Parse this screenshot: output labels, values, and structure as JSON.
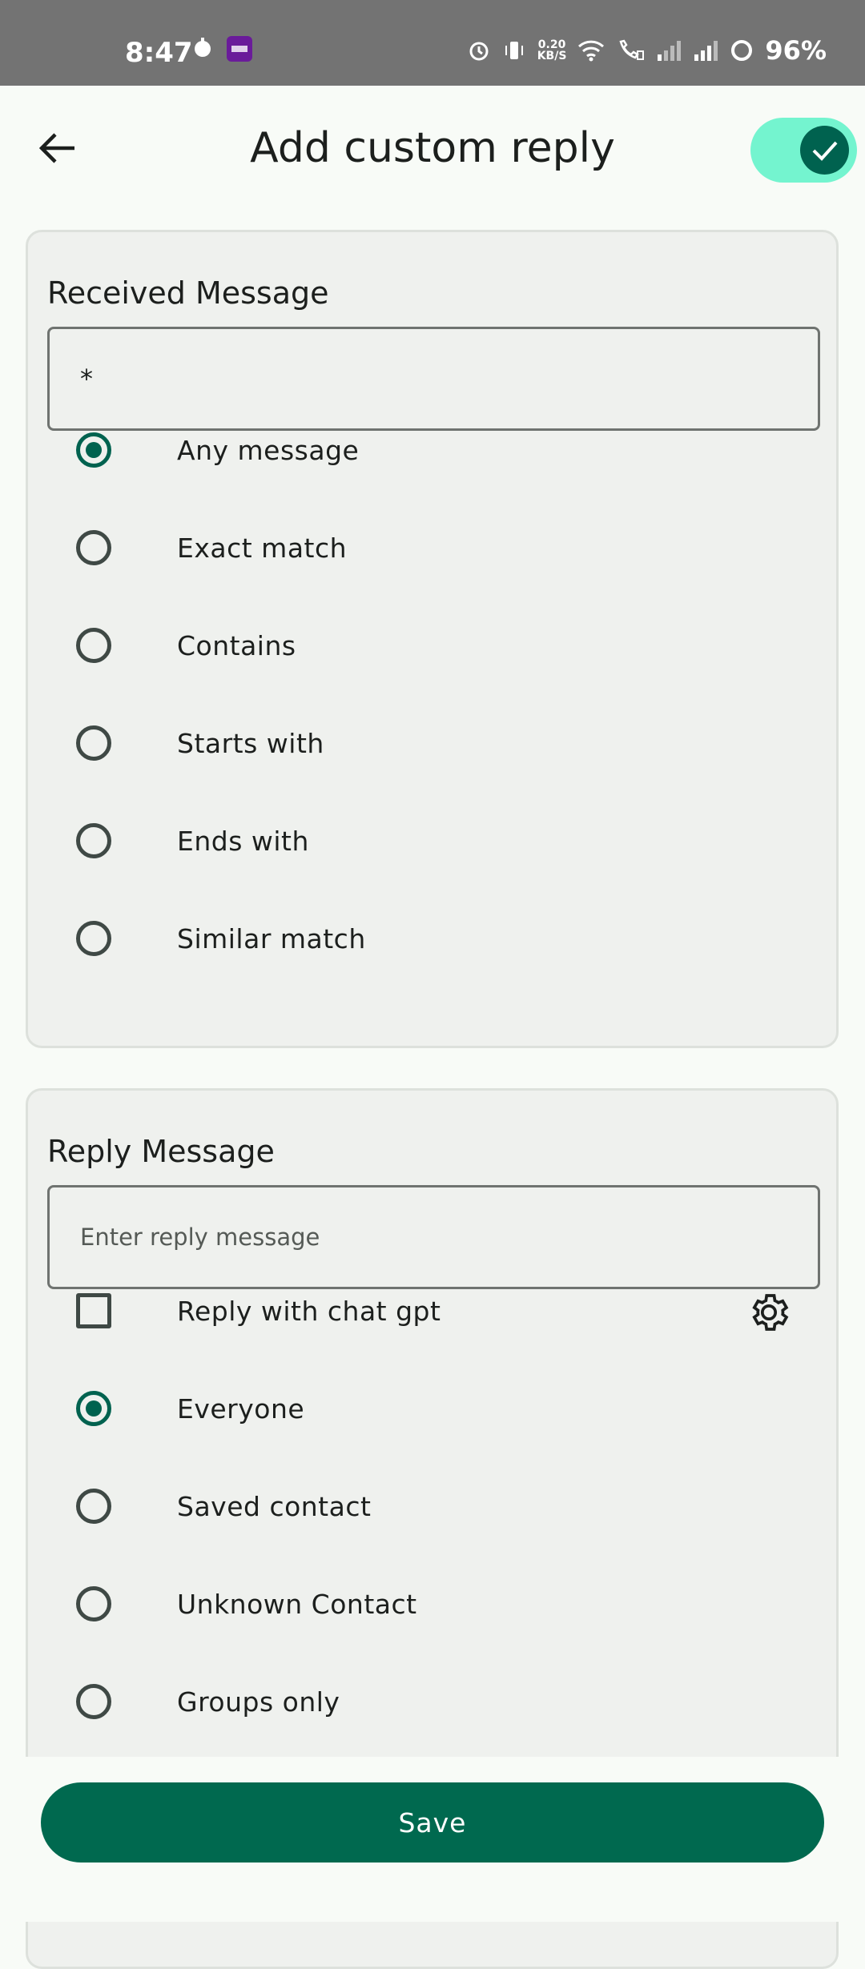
{
  "status_bar": {
    "time": "8:47",
    "speed_value": "0.20",
    "speed_unit": "KB/S",
    "battery": "96%",
    "icons": [
      "alarm-icon",
      "vibrate-icon",
      "wifi-icon",
      "call-icon",
      "signal-icon",
      "signal-icon",
      "battery-icon"
    ]
  },
  "header": {
    "title": "Add custom reply",
    "toggle_on": true
  },
  "received": {
    "title": "Received Message",
    "value": "*",
    "options": [
      {
        "label": "Any message",
        "selected": true
      },
      {
        "label": "Exact match",
        "selected": false
      },
      {
        "label": "Contains",
        "selected": false
      },
      {
        "label": "Starts with",
        "selected": false
      },
      {
        "label": "Ends with",
        "selected": false
      },
      {
        "label": "Similar match",
        "selected": false
      }
    ]
  },
  "reply": {
    "title": "Reply Message",
    "placeholder": "Enter reply message",
    "chat_gpt_label": "Reply with chat gpt",
    "options": [
      {
        "label": "Everyone",
        "selected": true
      },
      {
        "label": "Saved contact",
        "selected": false
      },
      {
        "label": "Unknown Contact",
        "selected": false
      },
      {
        "label": "Groups only",
        "selected": false
      }
    ]
  },
  "footer": {
    "save_label": "Save"
  },
  "colors": {
    "accent": "#00624f",
    "toggle_track": "#74f4cf",
    "status_bar": "#737373"
  }
}
